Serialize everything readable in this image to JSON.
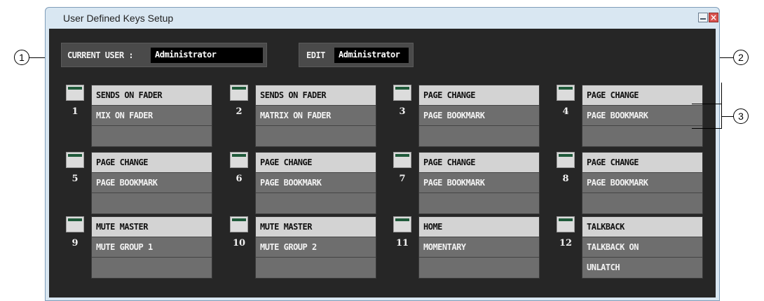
{
  "window": {
    "title": "User Defined Keys Setup"
  },
  "current_user": {
    "label": "CURRENT USER :",
    "value": "Administrator"
  },
  "edit": {
    "label": "EDIT",
    "value": "Administrator"
  },
  "callouts": [
    "1",
    "2",
    "3"
  ],
  "keys": [
    {
      "number": "1",
      "lines": [
        "SENDS ON FADER",
        "MIX ON FADER",
        ""
      ]
    },
    {
      "number": "2",
      "lines": [
        "SENDS ON FADER",
        "MATRIX ON FADER",
        ""
      ]
    },
    {
      "number": "3",
      "lines": [
        "PAGE CHANGE",
        "PAGE BOOKMARK",
        ""
      ]
    },
    {
      "number": "4",
      "lines": [
        "PAGE CHANGE",
        "PAGE BOOKMARK",
        ""
      ]
    },
    {
      "number": "5",
      "lines": [
        "PAGE CHANGE",
        "PAGE BOOKMARK",
        ""
      ]
    },
    {
      "number": "6",
      "lines": [
        "PAGE CHANGE",
        "PAGE BOOKMARK",
        ""
      ]
    },
    {
      "number": "7",
      "lines": [
        "PAGE CHANGE",
        "PAGE BOOKMARK",
        ""
      ]
    },
    {
      "number": "8",
      "lines": [
        "PAGE CHANGE",
        "PAGE BOOKMARK",
        ""
      ]
    },
    {
      "number": "9",
      "lines": [
        "MUTE MASTER",
        "MUTE GROUP 1",
        ""
      ]
    },
    {
      "number": "10",
      "lines": [
        "MUTE MASTER",
        "MUTE GROUP 2",
        ""
      ]
    },
    {
      "number": "11",
      "lines": [
        "HOME",
        "MOMENTARY",
        ""
      ]
    },
    {
      "number": "12",
      "lines": [
        "TALKBACK",
        "TALKBACK ON",
        "UNLATCH"
      ]
    }
  ]
}
